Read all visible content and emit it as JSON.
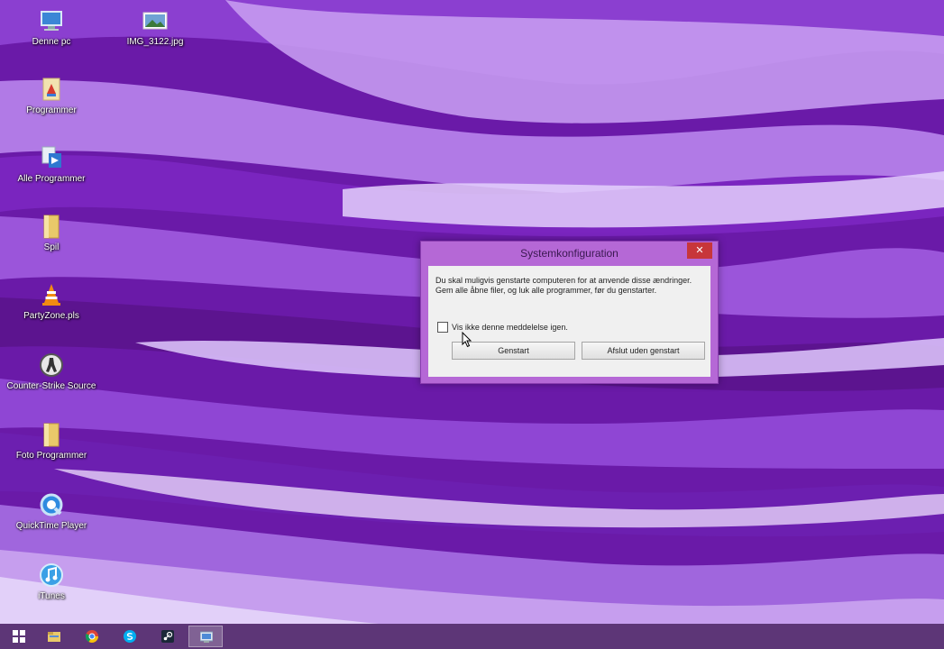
{
  "desktop": {
    "icons": [
      {
        "label": "Denne pc",
        "icon": "computer-icon"
      },
      {
        "label": "IMG_3122.jpg",
        "icon": "image-file-icon"
      },
      {
        "label": "Programmer",
        "icon": "programs-icon"
      },
      {
        "label": "Alle Programmer",
        "icon": "all-programs-icon"
      },
      {
        "label": "Spil",
        "icon": "folder-icon"
      },
      {
        "label": "PartyZone.pls",
        "icon": "vlc-playlist-icon"
      },
      {
        "label": "Counter-Strike Source",
        "icon": "counter-strike-icon"
      },
      {
        "label": "Foto Programmer",
        "icon": "folder-icon"
      },
      {
        "label": "QuickTime Player",
        "icon": "quicktime-icon"
      },
      {
        "label": "iTunes",
        "icon": "itunes-icon"
      }
    ]
  },
  "dialog": {
    "title": "Systemkonfiguration",
    "close_label": "✕",
    "message": "Du skal muligvis genstarte computeren for at anvende disse ændringer. Gem alle åbne filer, og luk alle programmer, før du genstarter.",
    "checkbox_label": "Vis ikke denne meddelelse igen.",
    "checkbox_checked": false,
    "restart_label": "Genstart",
    "exit_label": "Afslut uden genstart"
  },
  "taskbar": {
    "items": [
      {
        "icon": "windows-start-icon"
      },
      {
        "icon": "file-explorer-icon"
      },
      {
        "icon": "chrome-icon"
      },
      {
        "icon": "skype-icon"
      },
      {
        "icon": "steam-icon"
      },
      {
        "icon": "system-configuration-icon",
        "active": true
      }
    ]
  },
  "colors": {
    "wallpaper": "#6a1aa8",
    "dialog_frame": "#b568d6",
    "close_button": "#c7363a",
    "taskbar": "#5a3c6e"
  }
}
